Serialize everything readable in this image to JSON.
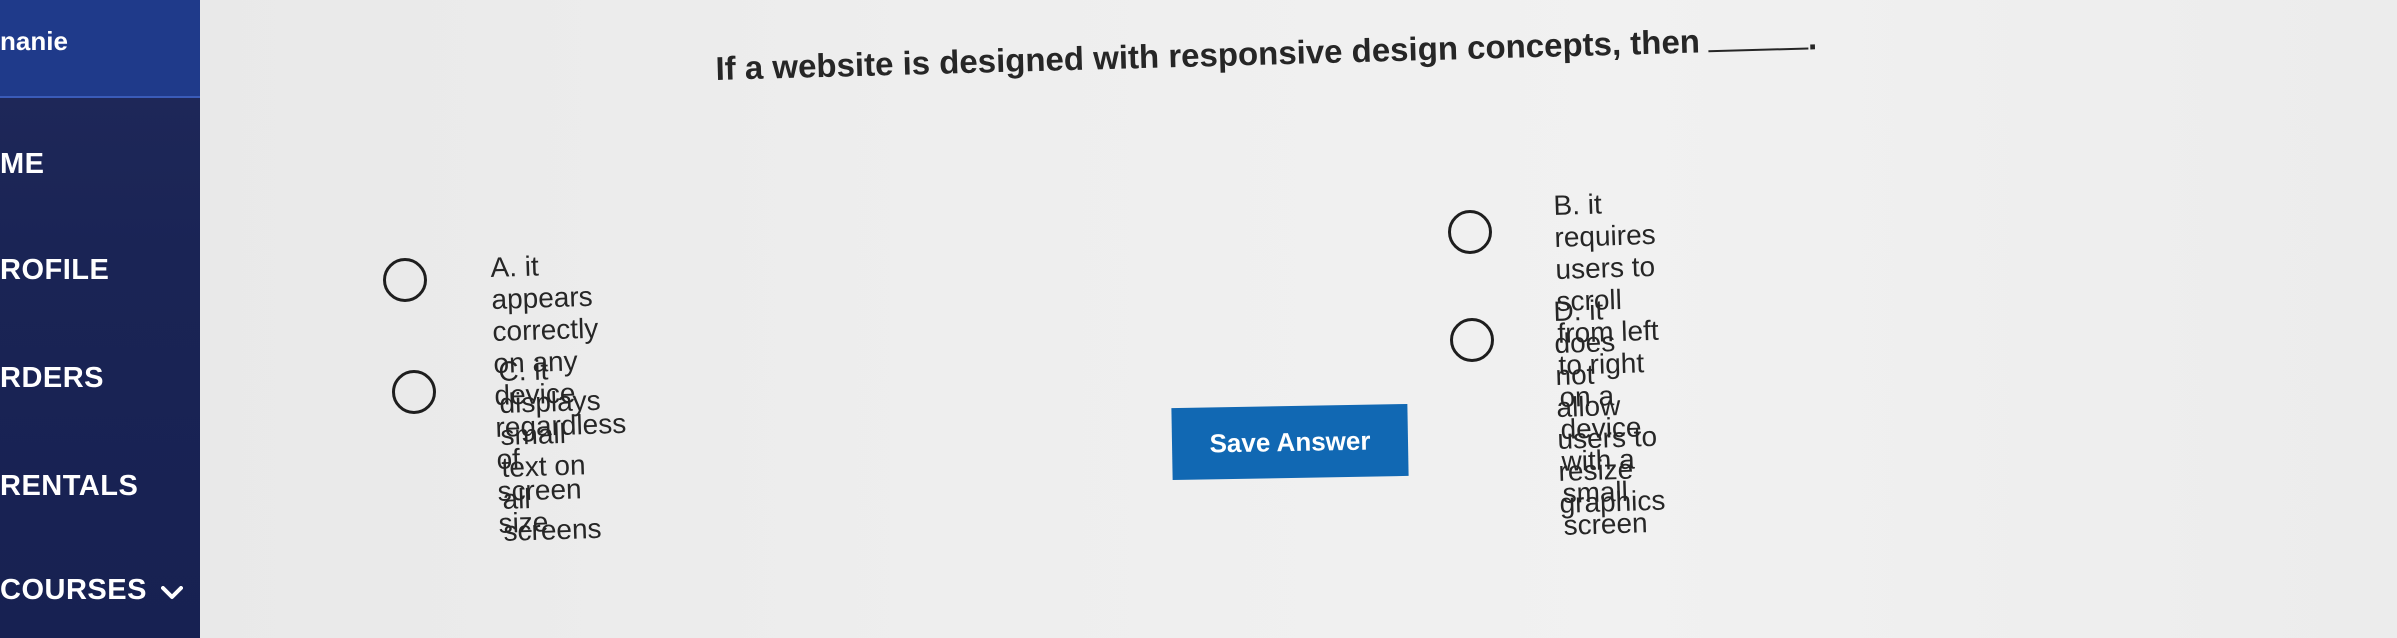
{
  "sidebar": {
    "user_name": "nanie",
    "items": [
      {
        "label": "ME"
      },
      {
        "label": "ROFILE"
      },
      {
        "label": "RDERS"
      },
      {
        "label": "RENTALS"
      },
      {
        "label": "COURSES"
      }
    ]
  },
  "question": {
    "text": "If a website is designed with responsive design concepts, then",
    "after_blank": "."
  },
  "options": [
    {
      "label": "A. it appears correctly on any device regardless of",
      "label2": "screen size"
    },
    {
      "label": "B. it requires users to scroll from left to right on a",
      "label2": "device with a small screen"
    },
    {
      "label": "C. it displays small text on all screens"
    },
    {
      "label": "D. it does not allow users to resize graphics"
    }
  ],
  "actions": {
    "save_label": "Save Answer"
  },
  "colors": {
    "sidebar_bg": "#1a2455",
    "accent_button": "#1168b3",
    "screen_bg": "#eeeeee"
  }
}
